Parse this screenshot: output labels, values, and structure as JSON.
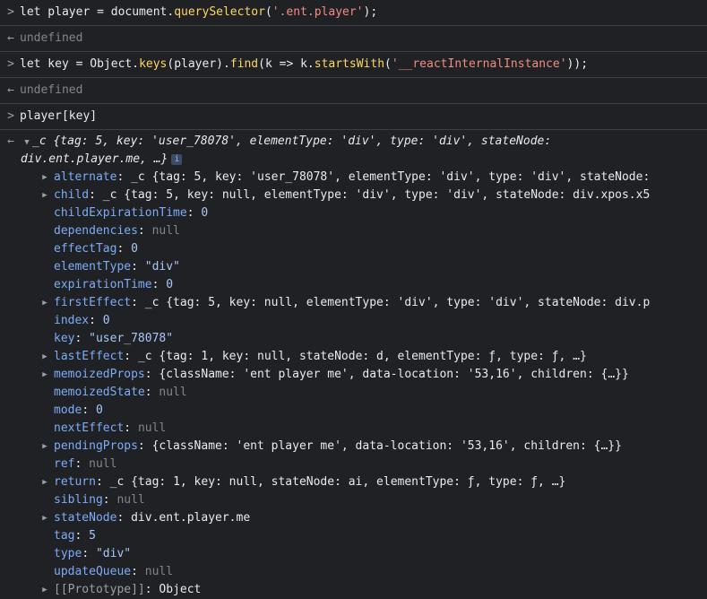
{
  "entries": {
    "cmd1": [
      "let player = document.",
      "querySelector",
      "(",
      "'.ent.player'",
      ");"
    ],
    "res1": "undefined",
    "cmd2": [
      "let key = Object.",
      "keys",
      "(player).",
      "find",
      "(k => k.",
      "startsWith",
      "(",
      "'__reactInternalInstance'",
      "));"
    ],
    "res2": "undefined",
    "cmd3": "player[key]"
  },
  "object": {
    "summary_line1": "_c {tag: 5, key: 'user_78078', elementType: 'div', type: 'div', stateNode:",
    "summary_line2": "div.ent.player.me, …}",
    "info_badge": "i",
    "props": [
      {
        "name": "alternate",
        "value": "_c {tag: 5, key: 'user_78078', elementType: 'div', type: 'div', stateNode:",
        "expandable": true
      },
      {
        "name": "child",
        "value": "_c {tag: 5, key: null, elementType: 'div', type: 'div', stateNode: div.xpos.x5",
        "expandable": true
      },
      {
        "name": "childExpirationTime",
        "value": "0",
        "kind": "num"
      },
      {
        "name": "dependencies",
        "value": "null",
        "kind": "null"
      },
      {
        "name": "effectTag",
        "value": "0",
        "kind": "num"
      },
      {
        "name": "elementType",
        "value": "\"div\"",
        "kind": "str"
      },
      {
        "name": "expirationTime",
        "value": "0",
        "kind": "num"
      },
      {
        "name": "firstEffect",
        "value": "_c {tag: 5, key: null, elementType: 'div', type: 'div', stateNode: div.p",
        "expandable": true
      },
      {
        "name": "index",
        "value": "0",
        "kind": "num"
      },
      {
        "name": "key",
        "value": "\"user_78078\"",
        "kind": "str"
      },
      {
        "name": "lastEffect",
        "value": "_c {tag: 1, key: null, stateNode: d, elementType: ƒ, type: ƒ, …}",
        "expandable": true
      },
      {
        "name": "memoizedProps",
        "value": "{className: 'ent player me', data-location: '53,16', children: {…}}",
        "expandable": true
      },
      {
        "name": "memoizedState",
        "value": "null",
        "kind": "null"
      },
      {
        "name": "mode",
        "value": "0",
        "kind": "num"
      },
      {
        "name": "nextEffect",
        "value": "null",
        "kind": "null"
      },
      {
        "name": "pendingProps",
        "value": "{className: 'ent player me', data-location: '53,16', children: {…}}",
        "expandable": true
      },
      {
        "name": "ref",
        "value": "null",
        "kind": "null"
      },
      {
        "name": "return",
        "value": "_c {tag: 1, key: null, stateNode: ai, elementType: ƒ, type: ƒ, …}",
        "expandable": true
      },
      {
        "name": "sibling",
        "value": "null",
        "kind": "null"
      },
      {
        "name": "stateNode",
        "value": "div.ent.player.me",
        "expandable": true,
        "kind": "node"
      },
      {
        "name": "tag",
        "value": "5",
        "kind": "num"
      },
      {
        "name": "type",
        "value": "\"div\"",
        "kind": "str"
      },
      {
        "name": "updateQueue",
        "value": "null",
        "kind": "null"
      },
      {
        "name": "[[Prototype]]",
        "value": "Object",
        "expandable": true,
        "kind": "proto"
      }
    ]
  },
  "colors": {
    "background": "#202124",
    "text": "#e8eaed",
    "property": "#7cacf8",
    "string": "#f28b82",
    "number": "#a8c7fa",
    "null": "#80868b"
  }
}
